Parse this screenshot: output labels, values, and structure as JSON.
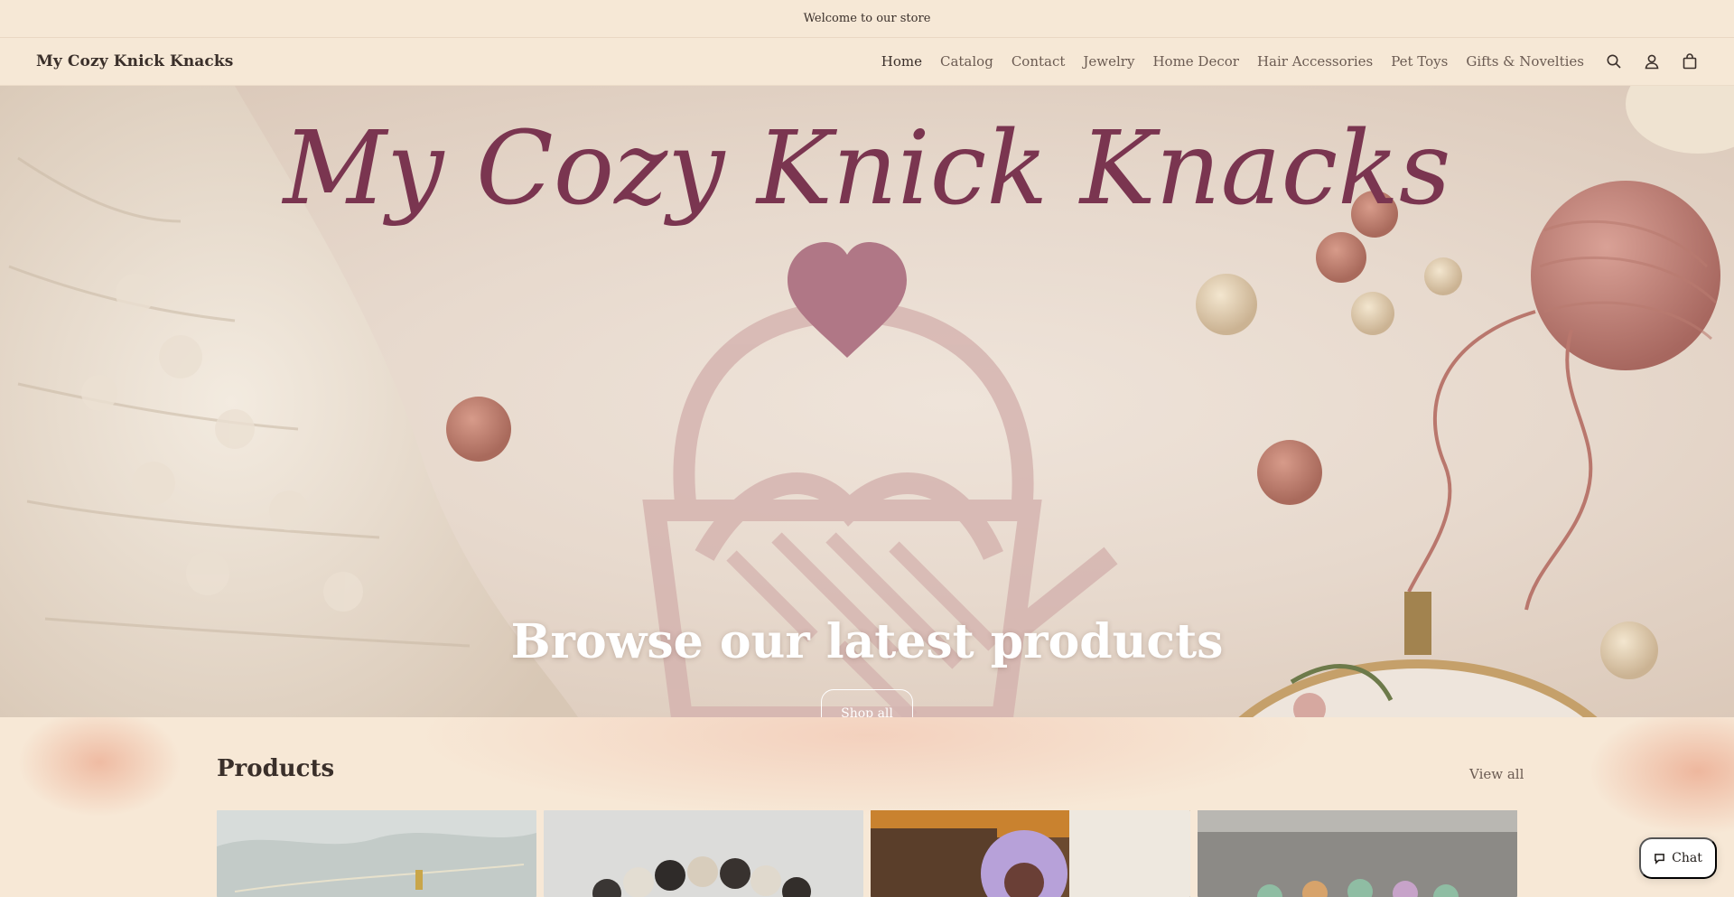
{
  "announcement": {
    "text": "Welcome to our store"
  },
  "header": {
    "store_name": "My Cozy Knick Knacks",
    "nav": [
      {
        "label": "Home",
        "active": true
      },
      {
        "label": "Catalog"
      },
      {
        "label": "Contact"
      },
      {
        "label": "Jewelry"
      },
      {
        "label": "Home Decor"
      },
      {
        "label": "Hair Accessories"
      },
      {
        "label": "Pet Toys"
      },
      {
        "label": "Gifts & Novelties"
      }
    ],
    "icons": [
      "search-icon",
      "account-icon",
      "cart-icon"
    ]
  },
  "hero": {
    "banner_script_text": "My Cozy Knick Knacks",
    "heading": "Browse our latest products",
    "button_label": "Shop all"
  },
  "products": {
    "heading": "Products",
    "view_all_label": "View all"
  },
  "chat": {
    "label": "Chat"
  },
  "colors": {
    "background": "#f7e9d6",
    "text": "#3a2f2a",
    "script_title": "#7a3550",
    "heart": "#b07786",
    "yarn": "#c98a80"
  }
}
